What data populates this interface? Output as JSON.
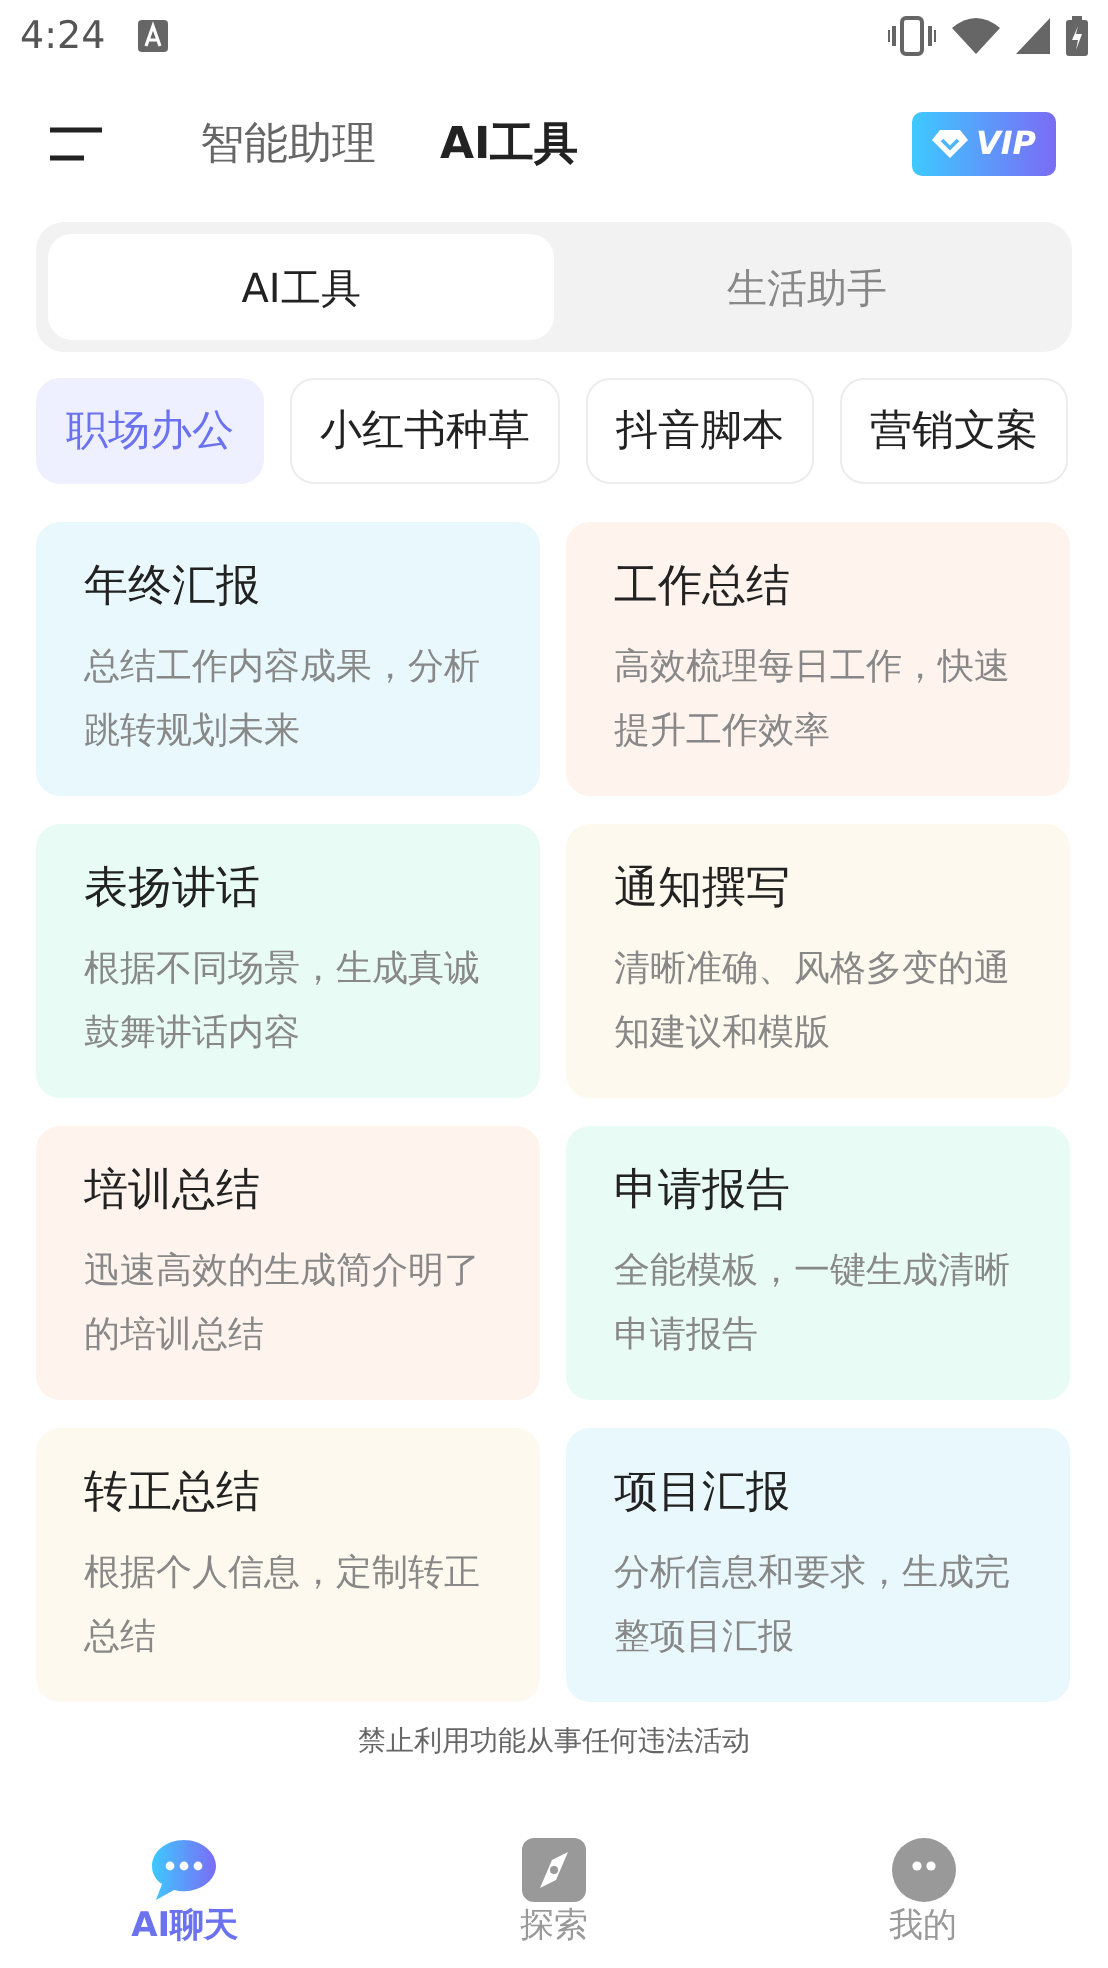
{
  "status_bar": {
    "time": "4:24"
  },
  "header": {
    "tabs": [
      {
        "label": "智能助理",
        "selected": false
      },
      {
        "label": "AI工具",
        "selected": true
      }
    ],
    "vip": "VIP"
  },
  "segment": [
    {
      "label": "AI工具",
      "selected": true
    },
    {
      "label": "生活助手",
      "selected": false
    }
  ],
  "chips": [
    {
      "label": "职场办公",
      "selected": true
    },
    {
      "label": "小红书种草",
      "selected": false
    },
    {
      "label": "抖音脚本",
      "selected": false
    },
    {
      "label": "营销文案",
      "selected": false
    }
  ],
  "cards": [
    {
      "title": "年终汇报",
      "desc": "总结工作内容成果，分析跳转规划未来",
      "color": "#e9f8fd"
    },
    {
      "title": "工作总结",
      "desc": "高效梳理每日工作，快速提升工作效率",
      "color": "#fff3ee"
    },
    {
      "title": "表扬讲话",
      "desc": "根据不同场景，生成真诚鼓舞讲话内容",
      "color": "#e9fbf5"
    },
    {
      "title": "通知撰写",
      "desc": "清晰准确、风格多变的通知建议和模版",
      "color": "#fdf9ee"
    },
    {
      "title": "培训总结",
      "desc": "迅速高效的生成简介明了的培训总结",
      "color": "#fff3ee"
    },
    {
      "title": "申请报告",
      "desc": "全能模板，一键生成清晰申请报告",
      "color": "#e9fbf5"
    },
    {
      "title": "转正总结",
      "desc": "根据个人信息，定制转正总结",
      "color": "#fdf9ee"
    },
    {
      "title": "项目汇报",
      "desc": "分析信息和要求，生成完整项目汇报",
      "color": "#e9f8fd"
    }
  ],
  "footer_note": "禁止利用功能从事任何违法活动",
  "bottom_nav": [
    {
      "label": "AI聊天",
      "kind": "chat",
      "selected": true
    },
    {
      "label": "探索",
      "kind": "explore",
      "selected": false
    },
    {
      "label": "我的",
      "kind": "profile",
      "selected": false
    }
  ]
}
